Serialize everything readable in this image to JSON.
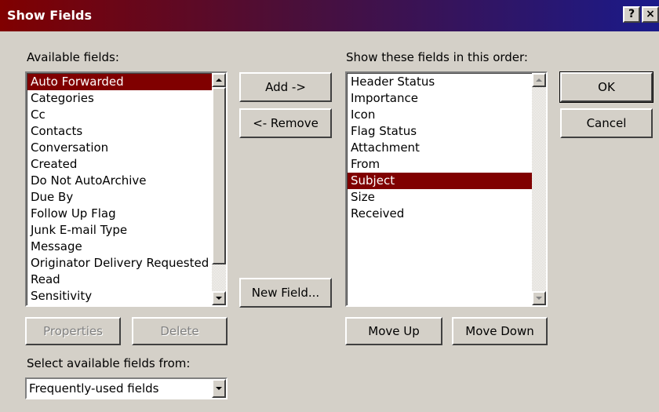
{
  "window": {
    "title": "Show Fields",
    "help_label": "?",
    "close_label": "×"
  },
  "available": {
    "label": "Available fields:",
    "items": [
      "Auto Forwarded",
      "Categories",
      "Cc",
      "Contacts",
      "Conversation",
      "Created",
      "Do Not AutoArchive",
      "Due By",
      "Follow Up Flag",
      "Junk E-mail Type",
      "Message",
      "Originator Delivery Requested",
      "Read",
      "Sensitivity"
    ],
    "selected_index": 0
  },
  "shown": {
    "label": "Show these fields in this order:",
    "items": [
      "Header Status",
      "Importance",
      "Icon",
      "Flag Status",
      "Attachment",
      "From",
      "Subject",
      "Size",
      "Received"
    ],
    "selected_index": 6
  },
  "buttons": {
    "add": "Add ->",
    "remove": "<- Remove",
    "new_field": "New Field...",
    "ok": "OK",
    "cancel": "Cancel",
    "properties": "Properties",
    "delete": "Delete",
    "move_up": "Move Up",
    "move_down": "Move Down"
  },
  "source": {
    "label": "Select available fields from:",
    "value": "Frequently-used fields"
  },
  "colors": {
    "selection": "#800000",
    "dialog_bg": "#d4d0c8"
  }
}
